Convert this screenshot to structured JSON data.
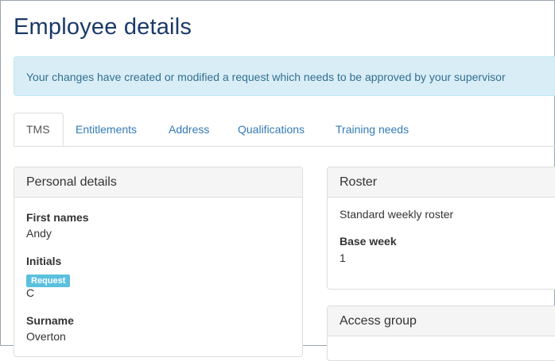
{
  "page_title": "Employee details",
  "alert": {
    "message": "Your changes have created or modified a request which needs to be approved by your supervisor"
  },
  "tabs": [
    {
      "label": "TMS",
      "active": true
    },
    {
      "label": "Entitlements",
      "active": false
    },
    {
      "label": "Address",
      "active": false
    },
    {
      "label": "Qualifications",
      "active": false
    },
    {
      "label": "Training needs",
      "active": false
    }
  ],
  "personal_details": {
    "heading": "Personal details",
    "first_names_label": "First names",
    "first_names_value": "Andy",
    "initials_label": "Initials",
    "initials_badge": "Request",
    "initials_value": "C",
    "surname_label": "Surname",
    "surname_value": "Overton"
  },
  "roster": {
    "heading": "Roster",
    "roster_value": "Standard weekly roster",
    "base_week_label": "Base week",
    "base_week_value": "1"
  },
  "access_group": {
    "heading": "Access group"
  },
  "colors": {
    "title": "#1b3a68",
    "link": "#337ab7",
    "alert_bg": "#d9edf7",
    "alert_text": "#31708f",
    "badge_bg": "#5bc0de"
  }
}
